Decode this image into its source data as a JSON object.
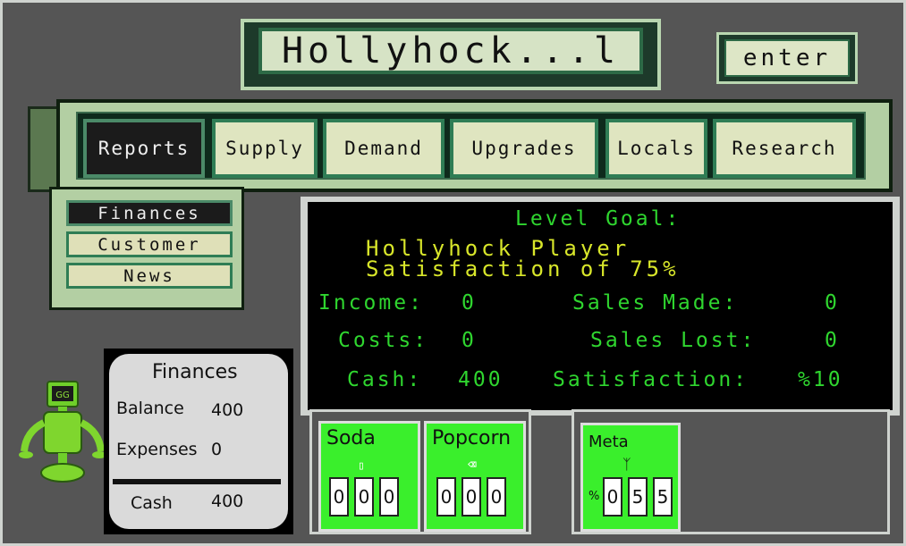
{
  "title": "Hollyhock...l",
  "enter_label": "enter",
  "nav": {
    "tabs": [
      "Reports",
      "Supply",
      "Demand",
      "Upgrades",
      "Locals",
      "Research"
    ]
  },
  "submenu": {
    "items": [
      "Finances",
      "Customer",
      "News"
    ]
  },
  "goal": {
    "heading": "Level Goal:",
    "line1": "Hollyhock Player",
    "line2": "Satisfaction of 75%",
    "income_label": "Income:",
    "income_value": "0",
    "costs_label": "Costs:",
    "costs_value": "0",
    "cash_label": "Cash:",
    "cash_value": "400",
    "sales_made_label": "Sales Made:",
    "sales_made_value": "0",
    "sales_lost_label": "Sales Lost:",
    "sales_lost_value": "0",
    "satisfaction_label": "Satisfaction:",
    "satisfaction_value": "%10"
  },
  "finances_card": {
    "title": "Finances",
    "balance_label": "Balance",
    "balance_value": "400",
    "expenses_label": "Expenses",
    "expenses_value": "0",
    "cash_label": "Cash",
    "cash_value": "400"
  },
  "mascot": {
    "badge": "GG"
  },
  "inventory": {
    "soda": {
      "label": "Soda",
      "digits": [
        "0",
        "0",
        "0"
      ],
      "icon": "cup-icon"
    },
    "popcorn": {
      "label": "Popcorn",
      "digits": [
        "0",
        "0",
        "0"
      ],
      "icon": "popcorn-icon"
    },
    "meta": {
      "label": "Meta",
      "prefix": "%",
      "digits": [
        "0",
        "5",
        "5"
      ],
      "icon": "meta-logo-icon"
    }
  },
  "colors": {
    "lime": "#3aef2c",
    "goal_green": "#2fd62f",
    "goal_yellow": "#d8e62a",
    "panel_green": "#b3cfa3",
    "tab_border": "#2f7d55"
  }
}
